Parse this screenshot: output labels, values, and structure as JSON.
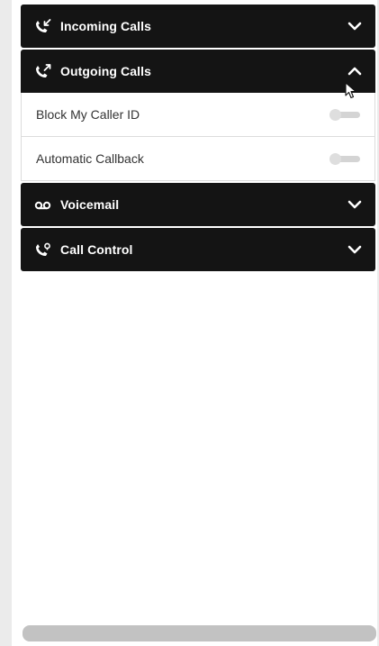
{
  "sections": [
    {
      "title": "Incoming Calls",
      "icon": "incoming-call-icon",
      "state": "collapsed"
    },
    {
      "title": "Outgoing Calls",
      "icon": "outgoing-call-icon",
      "state": "expanded"
    },
    {
      "title": "Voicemail",
      "icon": "voicemail-icon",
      "state": "collapsed"
    },
    {
      "title": "Call Control",
      "icon": "call-control-icon",
      "state": "collapsed"
    }
  ],
  "outgoing_settings": [
    {
      "label": "Block My Caller ID",
      "enabled": false
    },
    {
      "label": "Automatic Callback",
      "enabled": false
    }
  ],
  "colors": {
    "header_bg": "#141414",
    "header_text": "#ffffff",
    "toggle_off": "#d4d4d4"
  }
}
